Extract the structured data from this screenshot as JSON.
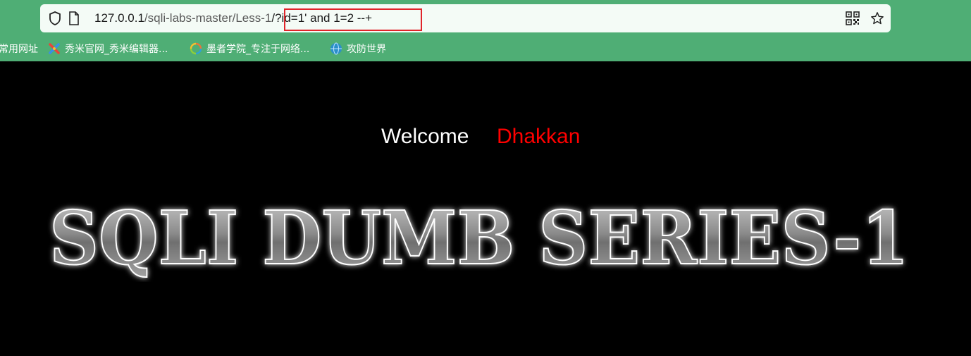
{
  "browser": {
    "url_host": "127.0.0.1",
    "url_path": "/sqli-labs-master/Less-1",
    "url_query": "/?id=1' and 1=2 --+",
    "bookmarks": [
      {
        "label": "常用网址",
        "icon": "folder-icon"
      },
      {
        "label": "秀米官网_秀米编辑器...",
        "icon": "xiumi-logo-icon"
      },
      {
        "label": "墨者学院_专注于网络...",
        "icon": "mozhe-logo-icon"
      },
      {
        "label": "攻防世界",
        "icon": "globe-icon"
      }
    ],
    "icons": [
      "shield-icon",
      "page-icon",
      "qr-code-icon",
      "star-icon"
    ]
  },
  "page": {
    "welcome": "Welcome",
    "user": "Dhakkan",
    "banner": "SQLI DUMB SERIES-1"
  },
  "colors": {
    "chrome": "#4fae75",
    "highlight": "#e0242a",
    "user": "#ff0000",
    "background": "#000000"
  }
}
